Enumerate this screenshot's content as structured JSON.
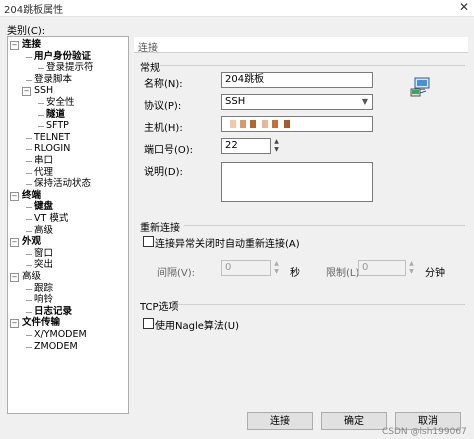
{
  "window": {
    "title": "204跳板属性",
    "close_glyph": "✕"
  },
  "category_label": "类别(C):",
  "tree": {
    "items": [
      {
        "label": "连接",
        "bold": true
      },
      {
        "label": "用户身份验证",
        "bold": true
      },
      {
        "label": "登录提示符",
        "bold": false
      },
      {
        "label": "登录脚本",
        "bold": false
      },
      {
        "label": "SSH",
        "bold": false
      },
      {
        "label": "安全性",
        "bold": false
      },
      {
        "label": "隧道",
        "bold": true
      },
      {
        "label": "SFTP",
        "bold": false
      },
      {
        "label": "TELNET",
        "bold": false
      },
      {
        "label": "RLOGIN",
        "bold": false
      },
      {
        "label": "串口",
        "bold": false
      },
      {
        "label": "代理",
        "bold": false
      },
      {
        "label": "保持活动状态",
        "bold": false
      },
      {
        "label": "终端",
        "bold": true
      },
      {
        "label": "键盘",
        "bold": true
      },
      {
        "label": "VT 模式",
        "bold": false
      },
      {
        "label": "高级",
        "bold": false
      },
      {
        "label": "外观",
        "bold": true
      },
      {
        "label": "窗口",
        "bold": false
      },
      {
        "label": "突出",
        "bold": false
      },
      {
        "label": "高级",
        "bold": false
      },
      {
        "label": "跟踪",
        "bold": false
      },
      {
        "label": "响铃",
        "bold": false
      },
      {
        "label": "日志记录",
        "bold": true
      },
      {
        "label": "文件传输",
        "bold": true
      },
      {
        "label": "X/YMODEM",
        "bold": false
      },
      {
        "label": "ZMODEM",
        "bold": false
      }
    ]
  },
  "breadcrumb": "连接",
  "general": {
    "title": "常规",
    "name_label": "名称(N):",
    "name_value": "204跳板",
    "protocol_label": "协议(P):",
    "protocol_value": "SSH",
    "host_label": "主机(H):",
    "port_label": "端口号(O):",
    "port_value": "22",
    "desc_label": "说明(D):",
    "desc_value": ""
  },
  "reconnect": {
    "title": "重新连接",
    "auto_label": "连接异常关闭时自动重新连接(A)",
    "interval_label": "间隔(V):",
    "interval_value": "0",
    "interval_unit": "秒",
    "limit_label": "限制(L):",
    "limit_value": "0",
    "limit_unit": "分钟"
  },
  "tcp": {
    "title": "TCP选项",
    "nagle_label": "使用Nagle算法(U)"
  },
  "buttons": {
    "connect": "连接",
    "ok": "确定",
    "cancel": "取消"
  },
  "watermark": "CSDN @lsh199067"
}
